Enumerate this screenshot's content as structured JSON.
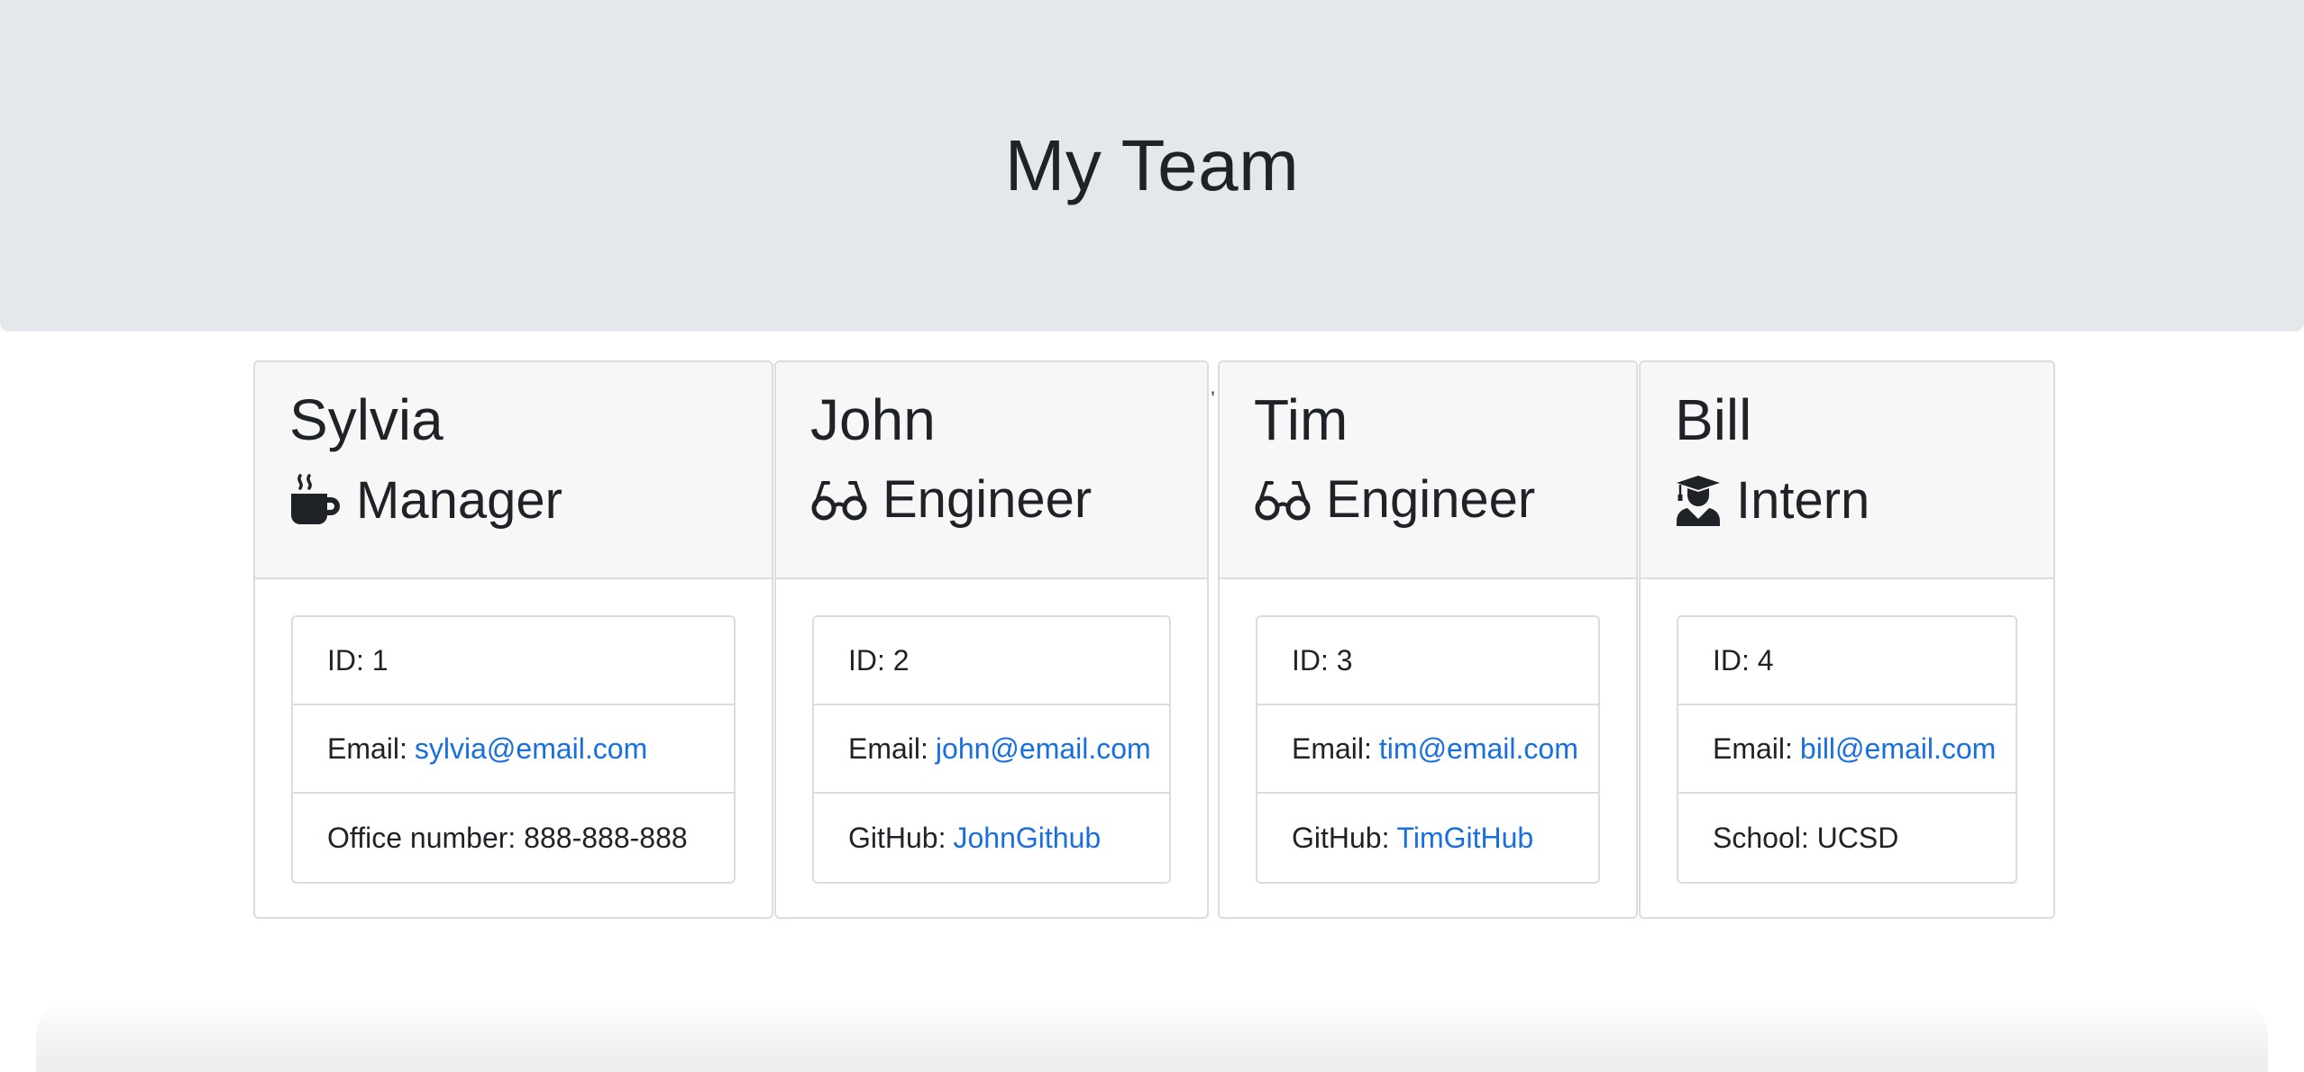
{
  "header": {
    "title": "My Team"
  },
  "stray_mark": "’",
  "employees": [
    {
      "name": "Sylvia",
      "role": "Manager",
      "icon": "mug-hot-icon",
      "id_label": "ID:",
      "id": "1",
      "email_label": "Email:",
      "email": "sylvia@email.com",
      "extra_label": "Office number:",
      "extra_value": "888-888-888"
    },
    {
      "name": "John",
      "role": "Engineer",
      "icon": "glasses-icon",
      "id_label": "ID:",
      "id": "2",
      "email_label": "Email:",
      "email": "john@email.com",
      "extra_label": "GitHub:",
      "extra_value": "JohnGithub"
    },
    {
      "name": "Tim",
      "role": "Engineer",
      "icon": "glasses-icon",
      "id_label": "ID:",
      "id": "3",
      "email_label": "Email:",
      "email": "tim@email.com",
      "extra_label": "GitHub:",
      "extra_value": "TimGitHub"
    },
    {
      "name": "Bill",
      "role": "Intern",
      "icon": "user-graduate-icon",
      "id_label": "ID:",
      "id": "4",
      "email_label": "Email:",
      "email": "bill@email.com",
      "extra_label": "School:",
      "extra_value": "UCSD"
    }
  ],
  "colors": {
    "link": "#1a6fe0",
    "jumbotron": "#e4e7ec",
    "card_header": "#f7f7f7"
  }
}
